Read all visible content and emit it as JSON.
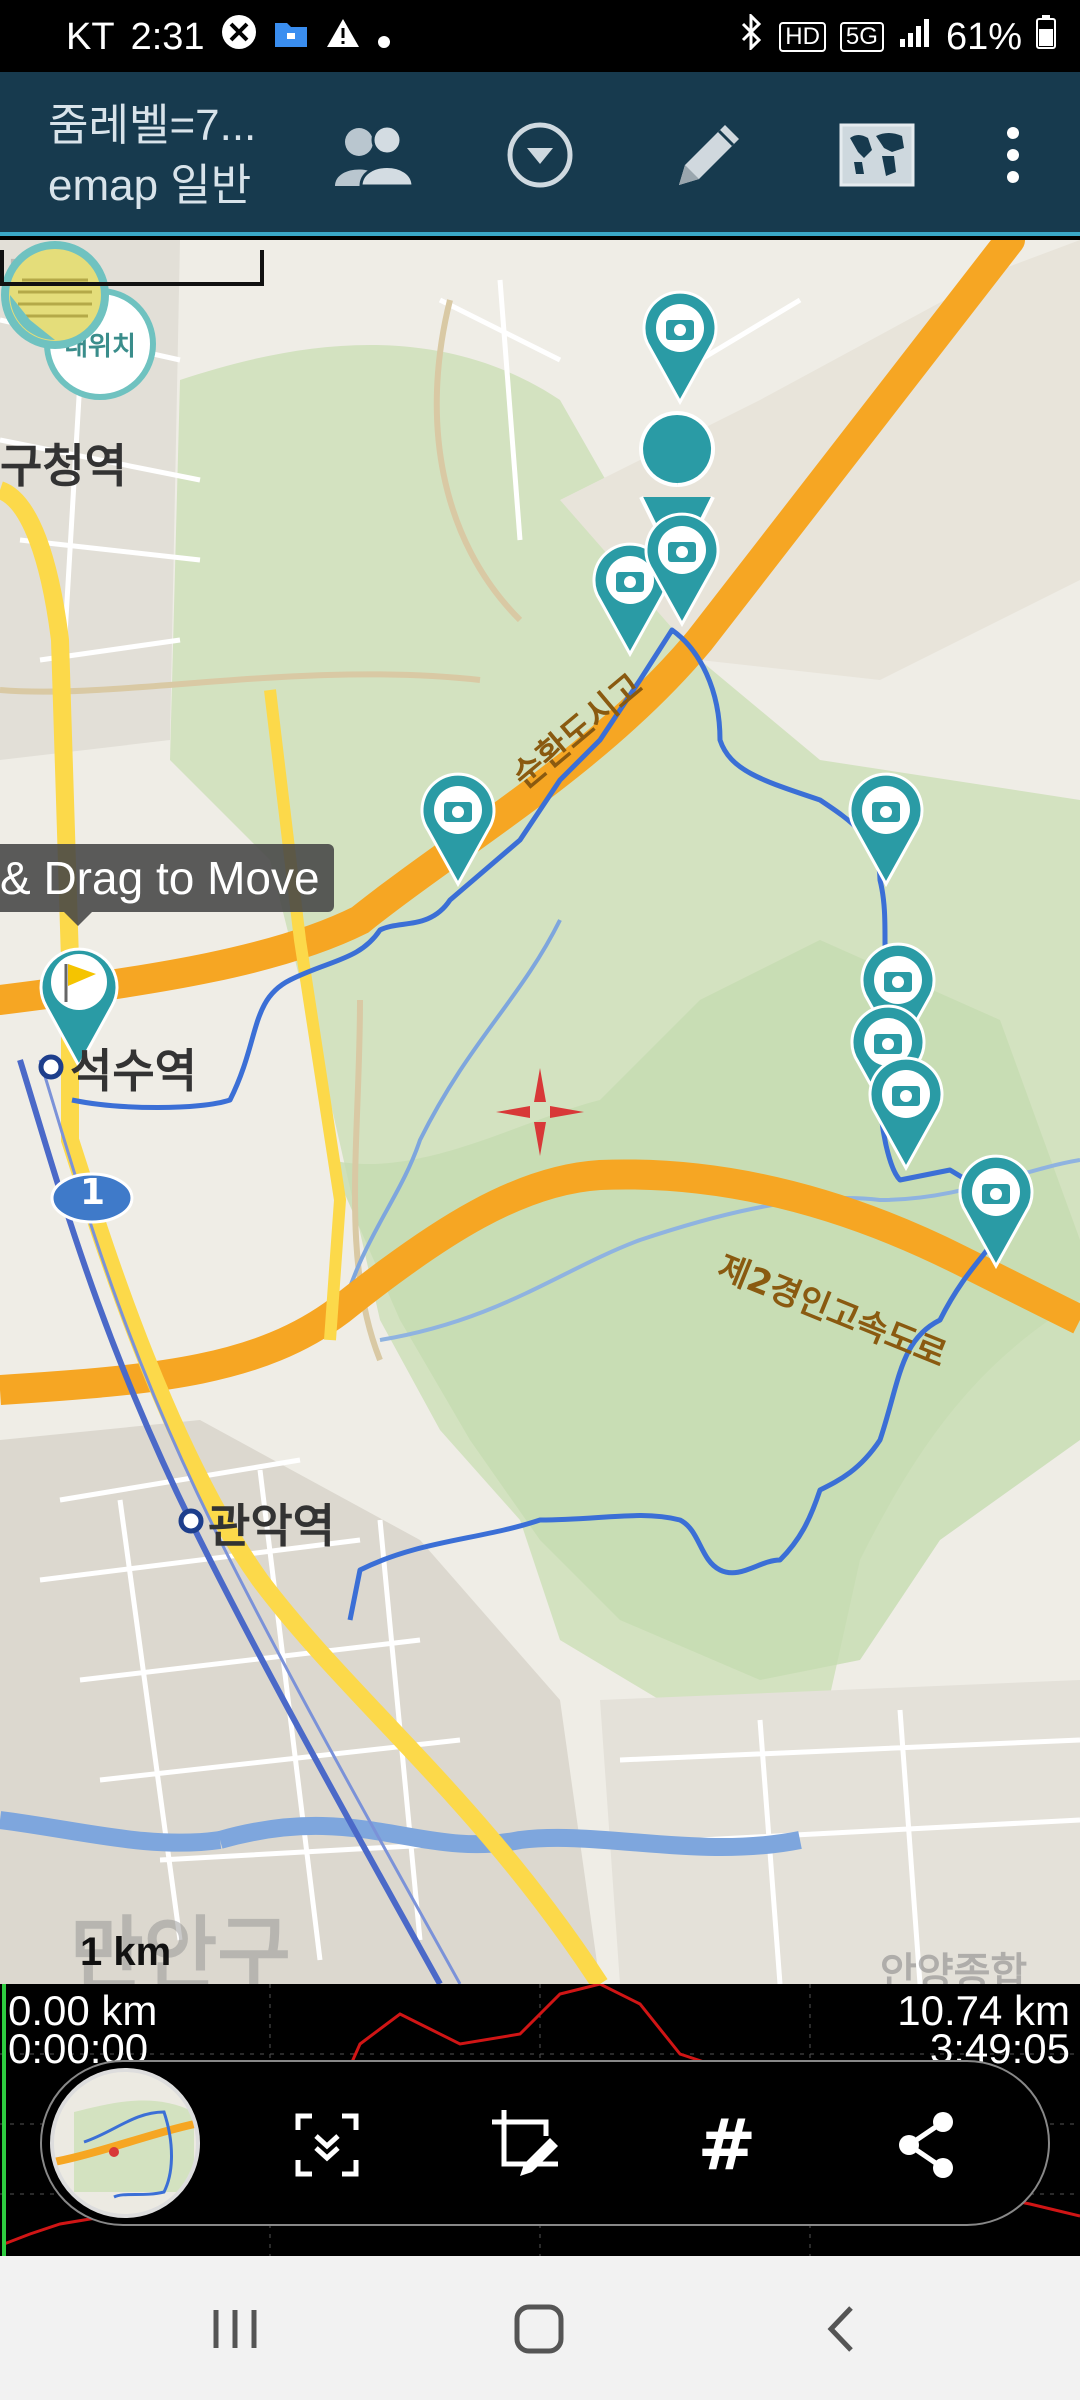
{
  "status_bar": {
    "carrier": "KT",
    "time": "2:31",
    "battery": "61%",
    "hd_label": "HD",
    "fiveg_label": "5G"
  },
  "toolbar": {
    "title_line1": "줌레벨=7...",
    "title_line2": "emap 일반",
    "icons": [
      "group-icon",
      "dropdown-icon",
      "pencil-icon",
      "world-map-icon",
      "more-icon"
    ]
  },
  "map": {
    "my_location_label": "내위치",
    "tooltip": "& Drag to Move",
    "scale_label": "1 km",
    "labels": {
      "gucheong": "구청역",
      "seoksu": "석수역",
      "gwanak": "관악역",
      "highway_1": "1",
      "highway2": "제2경인고속도로",
      "expressway_top": "순환도시고",
      "bottom_left": "만안구",
      "bottom_right": "안양종합",
      "left_edge": "구"
    },
    "route_color": "#3b6fd6",
    "marker_color": "#2a9ba5"
  },
  "elevation": {
    "start_distance": "0.00 km",
    "start_time": "0:00:00",
    "end_distance": "10.74 km",
    "end_time": "3:49:05",
    "profile_color": "#d01515"
  },
  "action_bar": {
    "icons": [
      "map-thumbnail",
      "collapse-icon",
      "edit-crop-icon",
      "hash-icon",
      "share-icon"
    ],
    "hash_symbol": "#"
  },
  "navbar": {
    "icons": [
      "recents-icon",
      "home-icon",
      "back-icon"
    ]
  }
}
